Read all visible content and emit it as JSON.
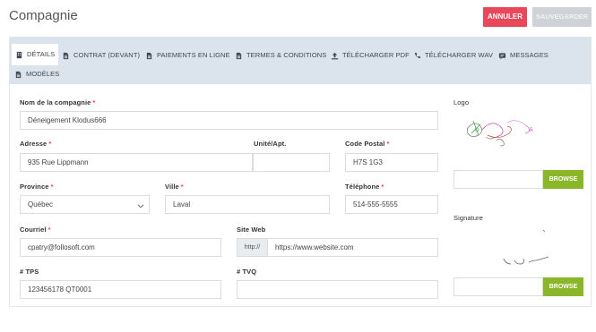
{
  "header": {
    "title": "Compagnie",
    "cancel_label": "ANNULER",
    "save_label": "SAUVEGARDER"
  },
  "tabs": [
    {
      "label": "DÉTAILS",
      "icon": "building-icon"
    },
    {
      "label": "CONTRAT (DEVANT)",
      "icon": "document-icon"
    },
    {
      "label": "PAIEMENTS EN LIGNE",
      "icon": "document-icon"
    },
    {
      "label": "TERMES & CONDITIONS",
      "icon": "document-icon"
    },
    {
      "label": "TÉLÉCHARGER PDF",
      "icon": "upload-icon"
    },
    {
      "label": "TÉLÉCHARGER WAV",
      "icon": "phone-icon"
    },
    {
      "label": "MESSAGES",
      "icon": "message-icon"
    },
    {
      "label": "MODÈLES",
      "icon": "document-icon"
    }
  ],
  "form": {
    "company_name": {
      "label": "Nom de la compagnie",
      "required": "*",
      "value": "Déneigement Klodus666"
    },
    "address": {
      "label": "Adresse",
      "required": "*",
      "value": "935 Rue Lippmann"
    },
    "unit": {
      "label": "Unité/Apt.",
      "value": ""
    },
    "postal_code": {
      "label": "Code Postal",
      "required": "*",
      "value": "H7S 1G3"
    },
    "province": {
      "label": "Province",
      "required": "*",
      "value": "Québec"
    },
    "city": {
      "label": "Ville",
      "required": "*",
      "value": "Laval"
    },
    "phone": {
      "label": "Téléphone",
      "required": "*",
      "value": "514-555-5555"
    },
    "email": {
      "label": "Courriel",
      "required": "*",
      "value": "cpatry@follosoft.com"
    },
    "website": {
      "label": "Site Web",
      "prefix": "http://",
      "value": "https://www.website.com"
    },
    "tps": {
      "label": "# TPS",
      "value": "123456178 QT0001"
    },
    "tvq": {
      "label": "# TVQ",
      "value": ""
    }
  },
  "logo": {
    "label": "Logo",
    "browse_label": "BROWSE"
  },
  "signature": {
    "label": "Signature",
    "browse_label": "BROWSE"
  },
  "colors": {
    "accent_red": "#e8485a",
    "browse_green": "#8ab629",
    "tab_bar": "#dbe3ec"
  }
}
